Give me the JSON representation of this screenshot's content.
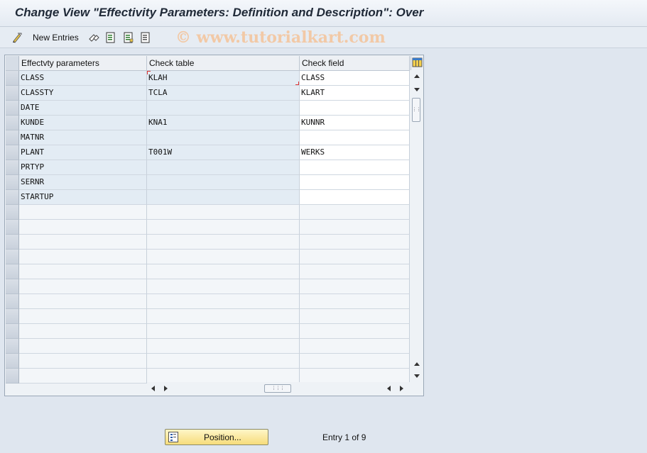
{
  "window": {
    "title": "Change View \"Effectivity Parameters: Definition and Description\": Over"
  },
  "toolbar": {
    "new_entries_label": "New Entries"
  },
  "watermark": "© www.tutorialkart.com",
  "table": {
    "columns": [
      "Effectvty parameters",
      "Check table",
      "Check field"
    ],
    "rows": [
      [
        "CLASS",
        "KLAH",
        "CLASS"
      ],
      [
        "CLASSTY",
        "TCLA",
        "KLART"
      ],
      [
        "DATE",
        "",
        ""
      ],
      [
        "KUNDE",
        "KNA1",
        "KUNNR"
      ],
      [
        "MATNR",
        "",
        ""
      ],
      [
        "PLANT",
        "T001W",
        "WERKS"
      ],
      [
        "PRTYP",
        "",
        ""
      ],
      [
        "SERNR",
        "",
        ""
      ],
      [
        "STARTUP",
        "",
        ""
      ]
    ],
    "empty_row_count": 12
  },
  "footer": {
    "position_label": "Position...",
    "entry_text": "Entry 1 of 9"
  },
  "colors": {
    "background": "#dfe6ef",
    "button_yellow": "#f6dc7a",
    "watermark": "#f2c9a6"
  }
}
